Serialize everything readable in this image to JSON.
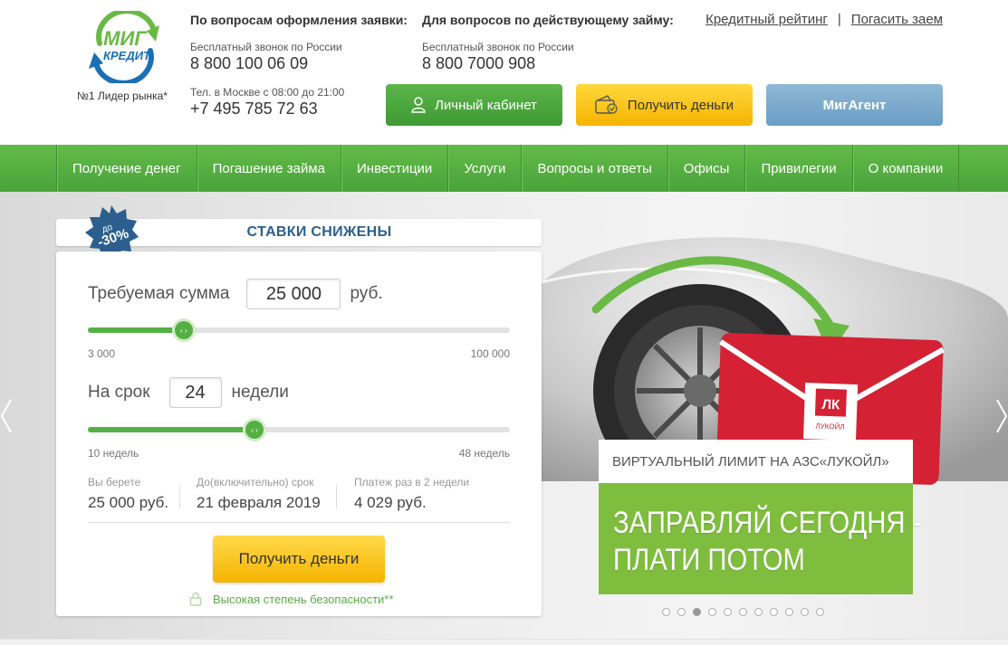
{
  "header": {
    "logo": {
      "line1": "МИГ",
      "line2": "КРЕДИТ",
      "tagline": "№1 Лидер рынка*",
      "colors": {
        "green": "#6ab945",
        "blue": "#1a6fb5"
      }
    },
    "contacts": [
      {
        "heading": "По вопросам оформления заявки:",
        "sub1": "Бесплатный звонок по России",
        "phone1": "8 800 100 06 09",
        "sub2": "Тел. в Москве с 08:00 до 21:00",
        "phone2": "+7 495 785 72 63"
      },
      {
        "heading": "Для вопросов по действующему займу:",
        "sub1": "Бесплатный звонок по России",
        "phone1": "8 800 7000 908"
      }
    ],
    "links": {
      "rating": "Кредитный рейтинг",
      "separator": "|",
      "repay": "Погасить заем"
    },
    "buttons": {
      "cabinet": {
        "label": "Личный кабинет",
        "icon": "user-icon"
      },
      "money": {
        "label": "Получить деньги",
        "icon": "wallet-icon"
      },
      "agent": {
        "label": "МигАгент"
      }
    }
  },
  "nav": {
    "items": [
      "Получение денег",
      "Погашение займа",
      "Инвестиции",
      "Услуги",
      "Вопросы и ответы",
      "Офисы",
      "Привилегии",
      "О компании"
    ]
  },
  "calculator": {
    "badge": {
      "line1": "до",
      "line2": "-30%"
    },
    "title": "СТАВКИ СНИЖЕНЫ",
    "amount": {
      "label": "Требуемая сумма",
      "value": "25 000",
      "unit": "руб.",
      "min_label": "3 000",
      "max_label": "100 000",
      "fraction": 0.227
    },
    "term": {
      "label": "На срок",
      "value": "24",
      "unit": "недели",
      "min_label": "10 недель",
      "max_label": "48 недель",
      "fraction": 0.395
    },
    "summary": [
      {
        "label": "Вы берете",
        "value": "25 000 руб."
      },
      {
        "label": "До(включительно) срок",
        "value": "21 февраля 2019"
      },
      {
        "label": "Платеж раз в 2 недели",
        "value": "4 029 руб."
      }
    ],
    "submit_label": "Получить деньги",
    "security_text": "Высокая степень безопасности**"
  },
  "banner": {
    "card_brand": "ЛУКОЙЛ",
    "card_logo": "ЛК",
    "subtitle": "ВИРТУАЛЬНЫЙ ЛИМИТ НА АЗС«ЛУКОЙЛ»",
    "headline_line1": "ЗАПРАВЛЯЙ СЕГОДНЯ -",
    "headline_line2": "ПЛАТИ ПОТОМ",
    "dots_total": 11,
    "dots_active": 3,
    "colors": {
      "promo_green": "#7ebd3e",
      "card_red": "#d42134"
    }
  }
}
